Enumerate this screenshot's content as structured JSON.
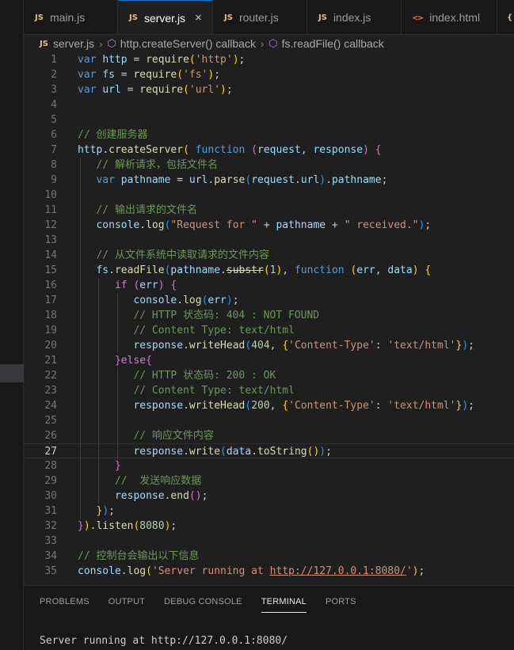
{
  "tabs": [
    {
      "label": "main.js",
      "icon": "js-icon",
      "active": false
    },
    {
      "label": "server.js",
      "icon": "js-icon",
      "active": true
    },
    {
      "label": "router.js",
      "icon": "js-icon",
      "active": false
    },
    {
      "label": "index.js",
      "icon": "js-icon",
      "active": false
    },
    {
      "label": "index.html",
      "icon": "html-icon",
      "active": false
    }
  ],
  "tab_icon_text": {
    "js": "JS",
    "html": "<>"
  },
  "tab_close_glyph": "×",
  "breadcrumb": {
    "file": "server.js",
    "items": [
      "http.createServer() callback",
      "fs.readFile() callback"
    ]
  },
  "editor": {
    "current_line": 27,
    "lines": [
      {
        "n": "1",
        "t": [
          [
            "kw",
            "var"
          ],
          [
            "pun",
            " "
          ],
          [
            "var",
            "http"
          ],
          [
            "pun",
            " = "
          ],
          [
            "fn",
            "require"
          ],
          [
            "br1",
            "("
          ],
          [
            "str",
            "'http'"
          ],
          [
            "br1",
            ")"
          ],
          [
            "pun",
            ";"
          ]
        ]
      },
      {
        "n": "2",
        "t": [
          [
            "kw",
            "var"
          ],
          [
            "pun",
            " "
          ],
          [
            "var",
            "fs"
          ],
          [
            "pun",
            " = "
          ],
          [
            "fn",
            "require"
          ],
          [
            "br1",
            "("
          ],
          [
            "str",
            "'fs'"
          ],
          [
            "br1",
            ")"
          ],
          [
            "pun",
            ";"
          ]
        ]
      },
      {
        "n": "3",
        "t": [
          [
            "kw",
            "var"
          ],
          [
            "pun",
            " "
          ],
          [
            "var",
            "url"
          ],
          [
            "pun",
            " = "
          ],
          [
            "fn",
            "require"
          ],
          [
            "br1",
            "("
          ],
          [
            "str",
            "'url'"
          ],
          [
            "br1",
            ")"
          ],
          [
            "pun",
            ";"
          ]
        ]
      },
      {
        "n": "4",
        "t": []
      },
      {
        "n": "5",
        "t": []
      },
      {
        "n": "6",
        "t": [
          [
            "cm",
            "// 创建服务器"
          ]
        ]
      },
      {
        "n": "7",
        "t": [
          [
            "var",
            "http"
          ],
          [
            "pun",
            "."
          ],
          [
            "fn",
            "createServer"
          ],
          [
            "br1",
            "("
          ],
          [
            "pun",
            " "
          ],
          [
            "kw",
            "function"
          ],
          [
            "pun",
            " "
          ],
          [
            "br2",
            "("
          ],
          [
            "var",
            "request"
          ],
          [
            "pun",
            ", "
          ],
          [
            "var",
            "response"
          ],
          [
            "br2",
            ")"
          ],
          [
            "pun",
            " "
          ],
          [
            "br2",
            "{"
          ]
        ]
      },
      {
        "n": "8",
        "t": [
          [
            "pun",
            "   "
          ],
          [
            "cm",
            "// 解析请求，包括文件名"
          ]
        ]
      },
      {
        "n": "9",
        "t": [
          [
            "pun",
            "   "
          ],
          [
            "kw",
            "var"
          ],
          [
            "pun",
            " "
          ],
          [
            "var",
            "pathname"
          ],
          [
            "pun",
            " = "
          ],
          [
            "var",
            "url"
          ],
          [
            "pun",
            "."
          ],
          [
            "fn",
            "parse"
          ],
          [
            "br3",
            "("
          ],
          [
            "var",
            "request"
          ],
          [
            "pun",
            "."
          ],
          [
            "var",
            "url"
          ],
          [
            "br3",
            ")"
          ],
          [
            "pun",
            "."
          ],
          [
            "var",
            "pathname"
          ],
          [
            "pun",
            ";"
          ]
        ]
      },
      {
        "n": "10",
        "t": []
      },
      {
        "n": "11",
        "t": [
          [
            "pun",
            "   "
          ],
          [
            "cm",
            "// 输出请求的文件名"
          ]
        ]
      },
      {
        "n": "12",
        "t": [
          [
            "pun",
            "   "
          ],
          [
            "var",
            "console"
          ],
          [
            "pun",
            "."
          ],
          [
            "fn",
            "log"
          ],
          [
            "br3",
            "("
          ],
          [
            "str",
            "\"Request for \""
          ],
          [
            "pun",
            " + "
          ],
          [
            "var",
            "pathname"
          ],
          [
            "pun",
            " + "
          ],
          [
            "str",
            "\" received.\""
          ],
          [
            "br3",
            ")"
          ],
          [
            "pun",
            ";"
          ]
        ]
      },
      {
        "n": "13",
        "t": []
      },
      {
        "n": "14",
        "t": [
          [
            "pun",
            "   "
          ],
          [
            "cm",
            "// 从文件系统中读取请求的文件内容"
          ]
        ]
      },
      {
        "n": "15",
        "t": [
          [
            "pun",
            "   "
          ],
          [
            "var",
            "fs"
          ],
          [
            "pun",
            "."
          ],
          [
            "fn",
            "readFile"
          ],
          [
            "br3",
            "("
          ],
          [
            "var",
            "pathname"
          ],
          [
            "pun",
            "."
          ],
          [
            "fn strike",
            "substr"
          ],
          [
            "br1",
            "("
          ],
          [
            "num",
            "1"
          ],
          [
            "br1",
            ")"
          ],
          [
            "pun",
            ", "
          ],
          [
            "kw",
            "function"
          ],
          [
            "pun",
            " "
          ],
          [
            "br1",
            "("
          ],
          [
            "var",
            "err"
          ],
          [
            "pun",
            ", "
          ],
          [
            "var",
            "data"
          ],
          [
            "br1",
            ")"
          ],
          [
            "pun",
            " "
          ],
          [
            "br1",
            "{"
          ]
        ]
      },
      {
        "n": "16",
        "t": [
          [
            "pun",
            "      "
          ],
          [
            "ctl",
            "if"
          ],
          [
            "pun",
            " "
          ],
          [
            "br2",
            "("
          ],
          [
            "var",
            "err"
          ],
          [
            "br2",
            ")"
          ],
          [
            "pun",
            " "
          ],
          [
            "br2",
            "{"
          ]
        ]
      },
      {
        "n": "17",
        "t": [
          [
            "pun",
            "         "
          ],
          [
            "var",
            "console"
          ],
          [
            "pun",
            "."
          ],
          [
            "fn",
            "log"
          ],
          [
            "br3",
            "("
          ],
          [
            "var",
            "err"
          ],
          [
            "br3",
            ")"
          ],
          [
            "pun",
            ";"
          ]
        ]
      },
      {
        "n": "18",
        "t": [
          [
            "pun",
            "         "
          ],
          [
            "cm",
            "// HTTP 状态码: 404 : NOT FOUND"
          ]
        ]
      },
      {
        "n": "19",
        "t": [
          [
            "pun",
            "         "
          ],
          [
            "cm",
            "// Content Type: text/html"
          ]
        ]
      },
      {
        "n": "20",
        "t": [
          [
            "pun",
            "         "
          ],
          [
            "var",
            "response"
          ],
          [
            "pun",
            "."
          ],
          [
            "fn",
            "writeHead"
          ],
          [
            "br3",
            "("
          ],
          [
            "num",
            "404"
          ],
          [
            "pun",
            ", "
          ],
          [
            "br1",
            "{"
          ],
          [
            "str",
            "'Content-Type'"
          ],
          [
            "pun",
            ": "
          ],
          [
            "str",
            "'text/html'"
          ],
          [
            "br1",
            "}"
          ],
          [
            "br3",
            ")"
          ],
          [
            "pun",
            ";"
          ]
        ]
      },
      {
        "n": "21",
        "t": [
          [
            "pun",
            "      "
          ],
          [
            "br2",
            "}"
          ],
          [
            "ctl",
            "else"
          ],
          [
            "br2",
            "{"
          ]
        ]
      },
      {
        "n": "22",
        "t": [
          [
            "pun",
            "         "
          ],
          [
            "cm",
            "// HTTP 状态码: 200 : OK"
          ]
        ]
      },
      {
        "n": "23",
        "t": [
          [
            "pun",
            "         "
          ],
          [
            "cm",
            "// Content Type: text/html"
          ]
        ]
      },
      {
        "n": "24",
        "t": [
          [
            "pun",
            "         "
          ],
          [
            "var",
            "response"
          ],
          [
            "pun",
            "."
          ],
          [
            "fn",
            "writeHead"
          ],
          [
            "br3",
            "("
          ],
          [
            "num",
            "200"
          ],
          [
            "pun",
            ", "
          ],
          [
            "br1",
            "{"
          ],
          [
            "str",
            "'Content-Type'"
          ],
          [
            "pun",
            ": "
          ],
          [
            "str",
            "'text/html'"
          ],
          [
            "br1",
            "}"
          ],
          [
            "br3",
            ")"
          ],
          [
            "pun",
            ";"
          ]
        ]
      },
      {
        "n": "25",
        "t": []
      },
      {
        "n": "26",
        "t": [
          [
            "pun",
            "         "
          ],
          [
            "cm",
            "// 响应文件内容"
          ]
        ]
      },
      {
        "n": "27",
        "t": [
          [
            "pun",
            "         "
          ],
          [
            "var",
            "response"
          ],
          [
            "pun",
            "."
          ],
          [
            "fn",
            "write"
          ],
          [
            "br3",
            "("
          ],
          [
            "var",
            "data"
          ],
          [
            "pun",
            "."
          ],
          [
            "fn",
            "toString"
          ],
          [
            "br1",
            "()"
          ],
          [
            "br3",
            ")"
          ],
          [
            "pun",
            ";"
          ]
        ]
      },
      {
        "n": "28",
        "t": [
          [
            "pun",
            "      "
          ],
          [
            "br2",
            "}"
          ]
        ]
      },
      {
        "n": "29",
        "t": [
          [
            "pun",
            "      "
          ],
          [
            "cm",
            "//  发送响应数据"
          ]
        ]
      },
      {
        "n": "30",
        "t": [
          [
            "pun",
            "      "
          ],
          [
            "var",
            "response"
          ],
          [
            "pun",
            "."
          ],
          [
            "fn",
            "end"
          ],
          [
            "br2",
            "()"
          ],
          [
            "pun",
            ";"
          ]
        ]
      },
      {
        "n": "31",
        "t": [
          [
            "pun",
            "   "
          ],
          [
            "br1",
            "}"
          ],
          [
            "br3",
            ")"
          ],
          [
            "pun",
            ";"
          ]
        ]
      },
      {
        "n": "32",
        "t": [
          [
            "br2",
            "}"
          ],
          [
            "br1",
            ")"
          ],
          [
            "pun",
            "."
          ],
          [
            "fn",
            "listen"
          ],
          [
            "br1",
            "("
          ],
          [
            "num",
            "8080"
          ],
          [
            "br1",
            ")"
          ],
          [
            "pun",
            ";"
          ]
        ]
      },
      {
        "n": "33",
        "t": []
      },
      {
        "n": "34",
        "t": [
          [
            "cm",
            "// 控制台会输出以下信息"
          ]
        ]
      },
      {
        "n": "35",
        "t": [
          [
            "var",
            "console"
          ],
          [
            "pun",
            "."
          ],
          [
            "fn",
            "log"
          ],
          [
            "br1",
            "("
          ],
          [
            "str",
            "'Server running at "
          ],
          [
            "str uline",
            "http://127.0.0.1:8080/"
          ],
          [
            "str",
            "'"
          ],
          [
            "br1",
            ")"
          ],
          [
            "pun",
            ";"
          ]
        ]
      }
    ]
  },
  "panel": {
    "tabs": [
      "PROBLEMS",
      "OUTPUT",
      "DEBUG CONSOLE",
      "TERMINAL",
      "PORTS"
    ],
    "active_tab": "TERMINAL",
    "terminal_output": "Server running at http://127.0.0.1:8080/"
  }
}
